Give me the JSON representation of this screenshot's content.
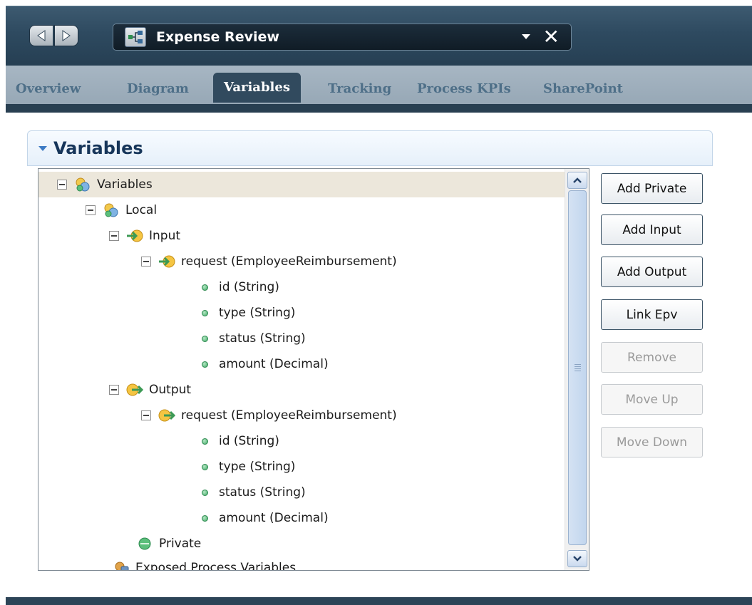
{
  "editor": {
    "title": "Expense Review",
    "icon": "process-diagram-icon"
  },
  "tabs": [
    {
      "label": "Overview",
      "active": false
    },
    {
      "label": "Diagram",
      "active": false
    },
    {
      "label": "Variables",
      "active": true
    },
    {
      "label": "Tracking",
      "active": false
    },
    {
      "label": "Process KPIs",
      "active": false
    },
    {
      "label": "SharePoint",
      "active": false
    }
  ],
  "section": {
    "title": "Variables"
  },
  "tree": {
    "root": "Variables",
    "local": "Local",
    "input": "Input",
    "input_request": "request (EmployeeReimbursement)",
    "input_fields": [
      "id (String)",
      "type (String)",
      "status (String)",
      "amount (Decimal)"
    ],
    "output": "Output",
    "output_request": "request (EmployeeReimbursement)",
    "output_fields": [
      "id (String)",
      "type (String)",
      "status (String)",
      "amount (Decimal)"
    ],
    "private": "Private",
    "exposed": "Exposed Process Variables"
  },
  "buttons": {
    "add_private": "Add Private",
    "add_input": "Add Input",
    "add_output": "Add Output",
    "link_epv": "Link Epv",
    "remove": "Remove",
    "move_up": "Move Up",
    "move_down": "Move Down"
  },
  "colors": {
    "header_dark": "#2e4a60",
    "tab_strip": "#a7b6c3",
    "active_tab": "#314a5e",
    "selected_row": "#ece7db"
  }
}
